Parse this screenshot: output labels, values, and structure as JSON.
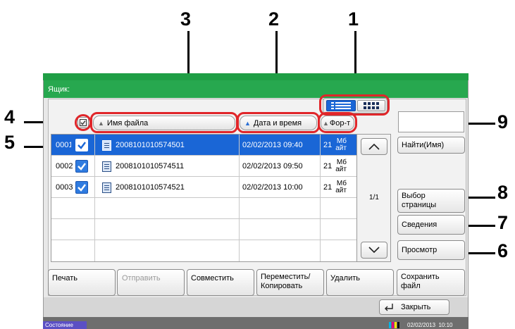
{
  "callouts": [
    "1",
    "2",
    "3",
    "4",
    "5",
    "6",
    "7",
    "8",
    "9"
  ],
  "window": {
    "title": "Ящик:"
  },
  "view_toggle": {
    "list_icon": "list-view-icon",
    "grid_icon": "grid-view-icon"
  },
  "header": {
    "select_all_icon": "select-all-checkbox-icon",
    "col_name": "Имя файла",
    "col_date": "Дата и время",
    "col_format": "Фор-т"
  },
  "files": [
    {
      "num": "0001",
      "name": "2008101010574501",
      "date": "02/02/2013 09:40",
      "size": "21",
      "unit_line1": "Мб",
      "unit_line2": "айт",
      "selected": true
    },
    {
      "num": "0002",
      "name": "2008101010574511",
      "date": "02/02/2013 09:50",
      "size": "21",
      "unit_line1": "Мб",
      "unit_line2": "айт",
      "selected": false
    },
    {
      "num": "0003",
      "name": "2008101010574521",
      "date": "02/02/2013 10:00",
      "size": "21",
      "unit_line1": "Мб",
      "unit_line2": "айт",
      "selected": false
    }
  ],
  "pager": {
    "page_text": "1/1",
    "up_icon": "chevron-up-icon",
    "down_icon": "chevron-down-icon"
  },
  "side_buttons": {
    "search_name": "Найти(Имя)",
    "select_page_line1": "Выбор",
    "select_page_line2": "страницы",
    "details": "Сведения",
    "preview": "Просмотр"
  },
  "bottom_buttons": {
    "print": "Печать",
    "send": "Отправить",
    "combine": "Совместить",
    "move_line1": "Переместить/",
    "move_line2": "Копировать",
    "delete": "Удалить",
    "save_line1": "Сохранить",
    "save_line2": "файл"
  },
  "close_button": {
    "label": "Закрыть",
    "icon": "return-arrow-icon"
  },
  "status": {
    "label": "Состояние",
    "datetime": "02/02/2013  10:10",
    "toner_icon": "toner-level-icon"
  },
  "colors": {
    "accent_green": "#27a84f",
    "selection_blue": "#1a66d6",
    "callout_red": "#e0262a"
  }
}
